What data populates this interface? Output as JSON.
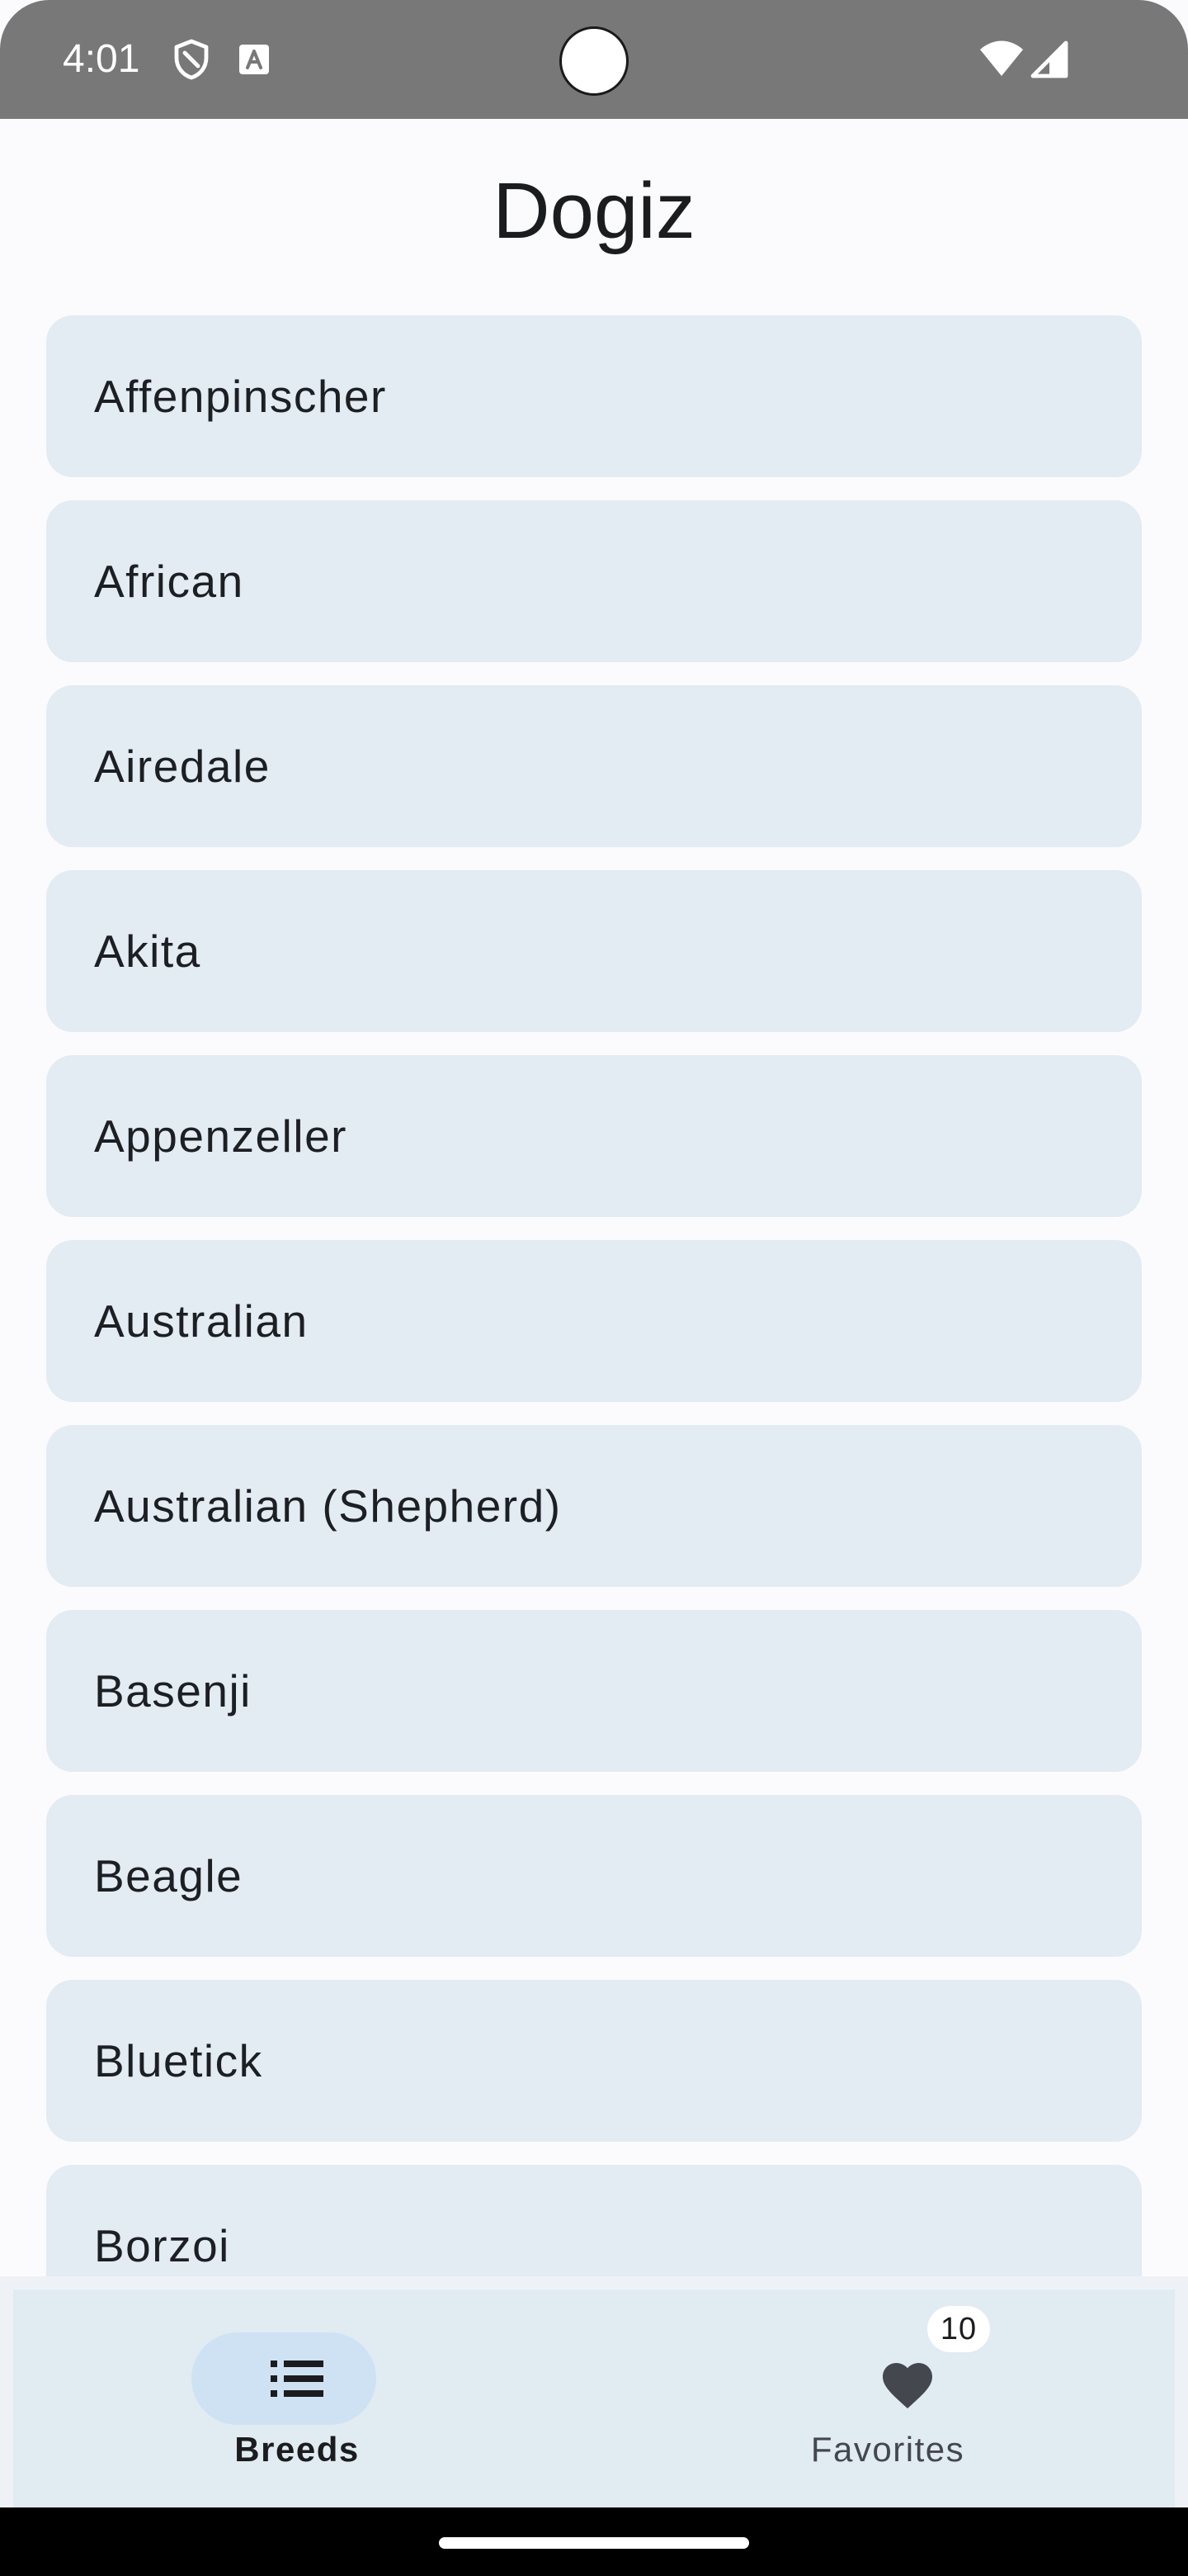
{
  "status_bar": {
    "time": "4:01",
    "icons": [
      "shield-icon",
      "a-icon",
      "wifi-icon",
      "signal-icon"
    ]
  },
  "app": {
    "title": "Dogiz"
  },
  "breeds": [
    "Affenpinscher",
    "African",
    "Airedale",
    "Akita",
    "Appenzeller",
    "Australian",
    "Australian (Shepherd)",
    "Basenji",
    "Beagle",
    "Bluetick",
    "Borzoi"
  ],
  "bottom_nav": {
    "breeds_label": "Breeds",
    "favorites_label": "Favorites",
    "favorites_badge": "10",
    "selected": "Breeds",
    "icons": [
      "list-icon",
      "heart-icon"
    ]
  },
  "colors": {
    "status_bar": "#787878",
    "background": "#fbfbfe",
    "list_item": "#e3ebf3",
    "nav_background": "#e1ebf2",
    "nav_indicator": "#cfe2f3",
    "text": "#1b1c1f"
  }
}
